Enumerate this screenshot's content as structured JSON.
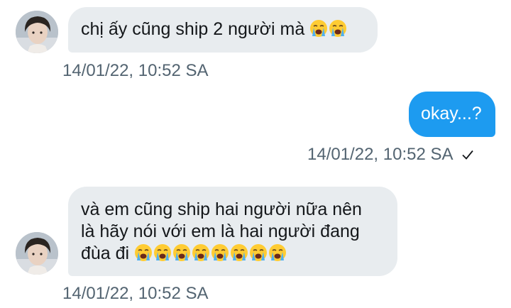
{
  "messages": [
    {
      "direction": "received",
      "text": "chị ấy cũng ship 2 người mà",
      "emoji_icons": [
        "loudly-crying-face-icon",
        "loudly-crying-face-icon"
      ],
      "timestamp": "14/01/22, 10:52 SA"
    },
    {
      "direction": "sent",
      "text": "okay...?",
      "timestamp": "14/01/22, 10:52 SA",
      "status_icon": "checkmark-icon"
    },
    {
      "direction": "received",
      "lines": [
        "và em cũng ship hai người nữa nên",
        "là hãy nói với em là hai người đang",
        "đùa đi"
      ],
      "emoji_icons": [
        "loudly-crying-face-icon",
        "loudly-crying-face-icon",
        "loudly-crying-face-icon",
        "loudly-crying-face-icon",
        "loudly-crying-face-icon",
        "loudly-crying-face-icon",
        "loudly-crying-face-icon",
        "loudly-crying-face-icon"
      ],
      "timestamp": "14/01/22, 10:52 SA"
    }
  ],
  "colors": {
    "received_bubble": "#e8ecef",
    "sent_bubble": "#1d9bf0",
    "timestamp_text": "#536471"
  }
}
